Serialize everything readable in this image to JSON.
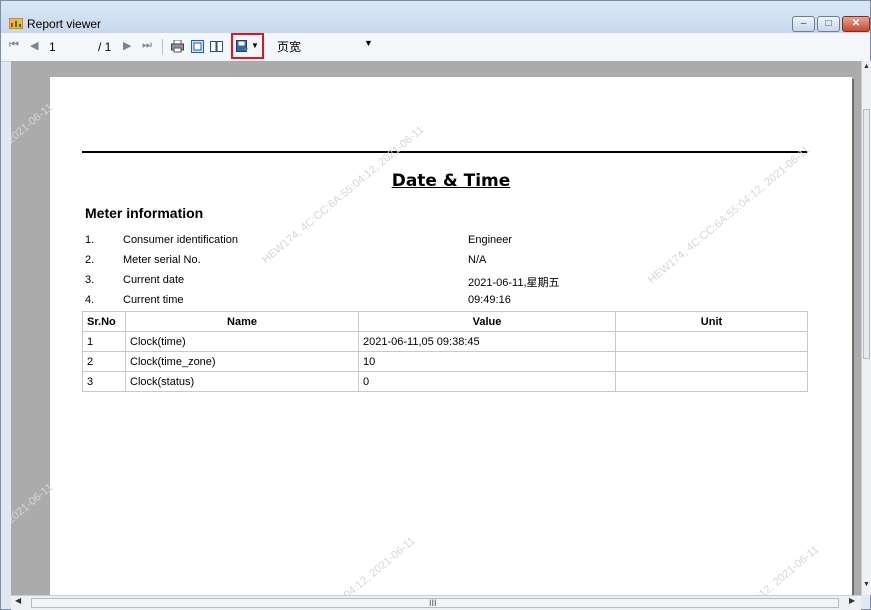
{
  "window": {
    "title": "Report viewer"
  },
  "toolbar": {
    "page_current": "1",
    "page_total": "/ 1",
    "zoom_value": "页宽",
    "first_icon": "first-page-icon",
    "prev_icon": "previous-page-icon",
    "next_icon": "next-page-icon",
    "last_icon": "last-page-icon",
    "print_icon": "print-icon",
    "print_layout_icon": "print-layout-icon",
    "page_setup_icon": "page-setup-icon",
    "export_icon": "export-icon",
    "highlight_color": "#e0141b"
  },
  "report": {
    "title": "Date & Time",
    "section_title": "Meter information",
    "info": [
      {
        "num": "1.",
        "label": "Consumer identification",
        "value": "Engineer"
      },
      {
        "num": "2.",
        "label": "Meter serial No.",
        "value": "N/A"
      },
      {
        "num": "3.",
        "label": "Current date",
        "value": "2021-06-11,星期五"
      },
      {
        "num": "4.",
        "label": "Current time",
        "value": "09:49:16"
      }
    ],
    "table": {
      "headers": [
        "Sr.No",
        "Name",
        "Value",
        "Unit"
      ],
      "rows": [
        [
          "1",
          "Clock(time)",
          "2021-06-11,05 09:38:45",
          ""
        ],
        [
          "2",
          "Clock(time_zone)",
          "10",
          ""
        ],
        [
          "3",
          "Clock(status)",
          "0",
          ""
        ]
      ]
    },
    "watermarks": [
      "2021-06-11",
      "HEW174, 4C:CC:6A:55:04:12, 2021-06-11",
      "HEW174, 4C:CC:6A:55:04:12, 2021-06-11",
      "2021-06-11",
      "55:04:12, 2021-06-11",
      "4:12, 2021-06-11"
    ]
  },
  "scrollbar": {
    "grip": "III"
  }
}
